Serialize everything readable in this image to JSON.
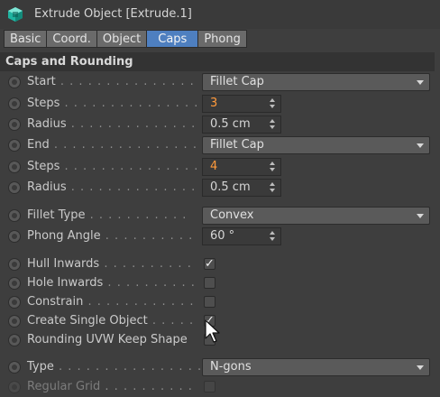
{
  "window": {
    "title": "Extrude Object [Extrude.1]"
  },
  "tabs": [
    {
      "label": "Basic"
    },
    {
      "label": "Coord."
    },
    {
      "label": "Object"
    },
    {
      "label": "Caps",
      "active": true
    },
    {
      "label": "Phong"
    }
  ],
  "section": {
    "title": "Caps and Rounding"
  },
  "rows": {
    "start": {
      "label": "Start",
      "dots": " . . . . . . . . . . . . . . .",
      "value": "Fillet Cap"
    },
    "steps1": {
      "label": "Steps",
      "dots": " . . . . . . . . . . . . . . .",
      "value": "3"
    },
    "radius1": {
      "label": "Radius",
      "dots": " . . . . . . . . . . . . . .",
      "value": "0.5 cm"
    },
    "end": {
      "label": "End",
      "dots": " . . . . . . . . . . . . . . . .",
      "value": "Fillet Cap"
    },
    "steps2": {
      "label": "Steps",
      "dots": " . . . . . . . . . . . . . . .",
      "value": "4"
    },
    "radius2": {
      "label": "Radius",
      "dots": " . . . . . . . . . . . . . .",
      "value": "0.5 cm"
    },
    "fillet_type": {
      "label": "Fillet Type",
      "dots": " . . . . . . . . . . .",
      "value": "Convex"
    },
    "phong_angle": {
      "label": "Phong Angle",
      "dots": " . . . . . . . . . .",
      "value": "60 °"
    },
    "hull_inwards": {
      "label": "Hull Inwards",
      "dots": " . . . . . . . . . .",
      "checked": true,
      "mark": "✓"
    },
    "hole_inwards": {
      "label": "Hole Inwards",
      "dots": " . . . . . . . . . .",
      "checked": false
    },
    "constrain": {
      "label": "Constrain",
      "dots": " . . . . . . . . . . . .",
      "checked": false
    },
    "create_single": {
      "label": "Create Single Object",
      "dots": " . . . . .",
      "checked": true,
      "mark": "✓"
    },
    "rounding_uvw": {
      "label": "Rounding UVW Keep Shape",
      "dots": "",
      "checked": false
    },
    "type": {
      "label": "Type",
      "dots": " . . . . . . . . . . . . . . . .",
      "value": "N-gons"
    },
    "regular_grid": {
      "label": "Regular Grid",
      "dots": " . . . . . . . . . .",
      "checked": false
    }
  },
  "colors": {
    "accent_tab": "#4e7fc0",
    "background": "#3e3e3e",
    "edited_value": "#ff9a3c",
    "icon_teal": "#1fb3a0"
  },
  "icons": {
    "title": "extrude-object-icon",
    "radio": "animation-keyframe-radio-icon",
    "dropdown": "chevron-down-icon",
    "spinner": "spinner-arrows-icon",
    "check": "checkmark-icon",
    "cursor": "mouse-pointer-icon"
  }
}
